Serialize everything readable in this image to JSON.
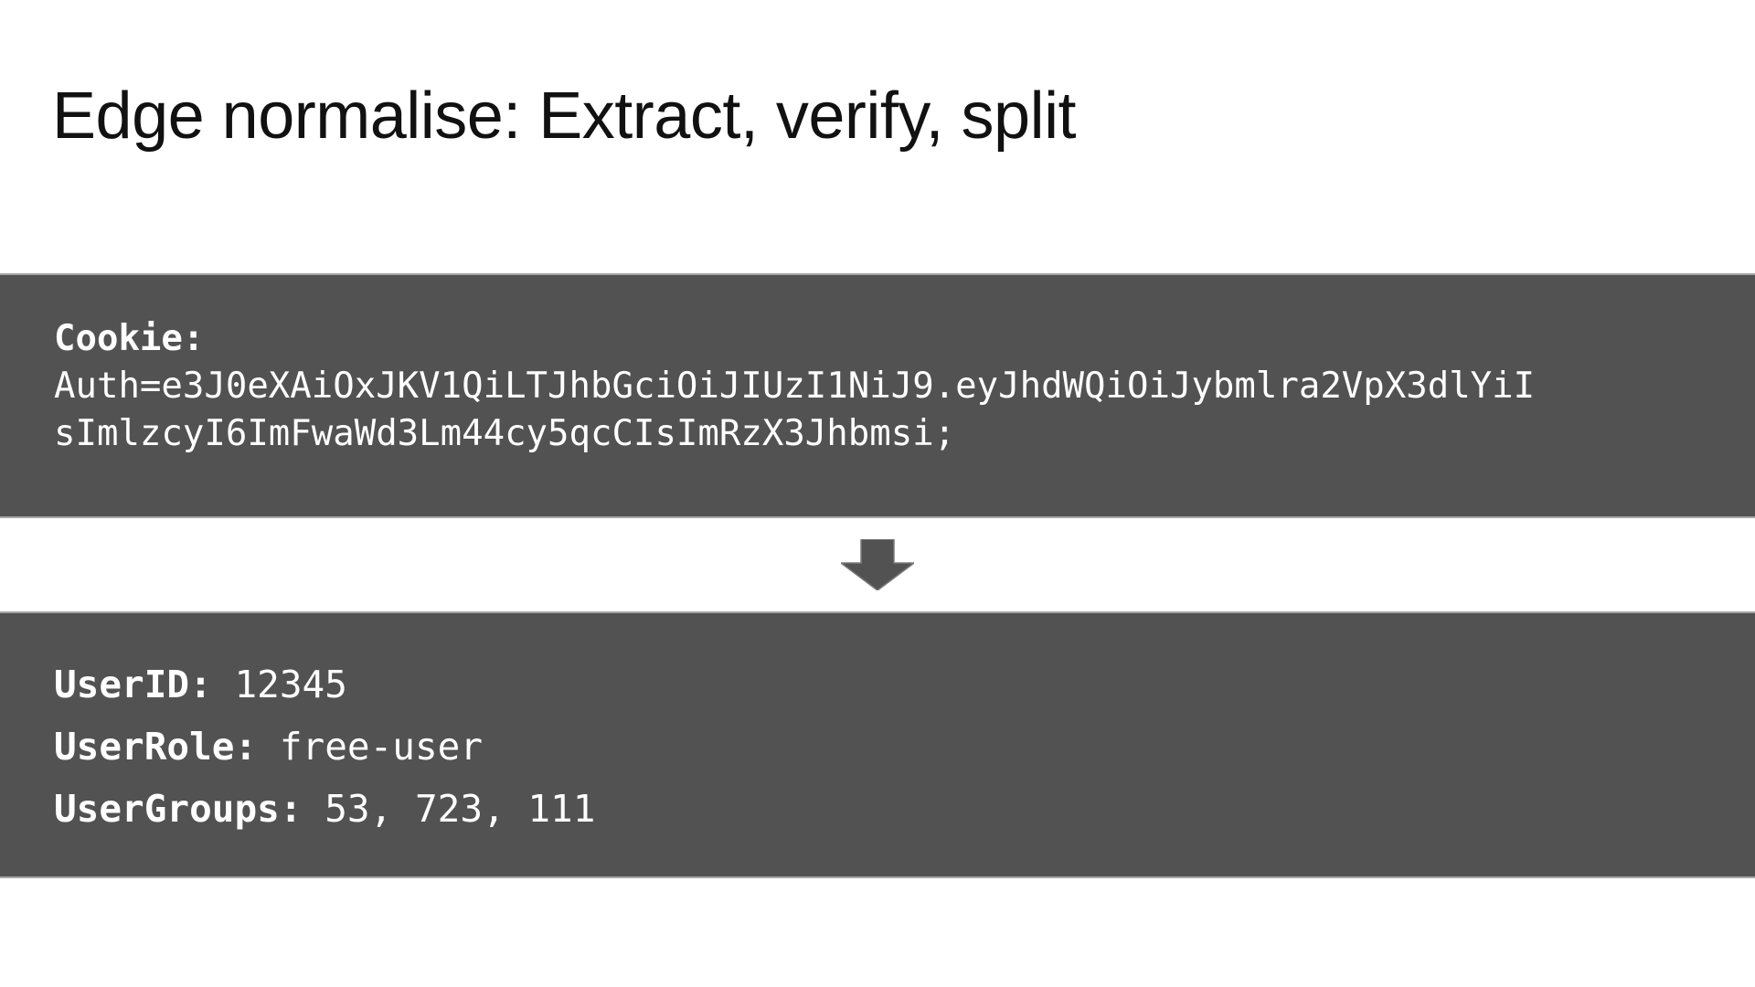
{
  "slide": {
    "title": "Edge normalise: Extract, verify, split"
  },
  "cookie": {
    "label": "Cookie:",
    "line1": "Auth=e3J0eXAiOxJKV1QiLTJhbGciOiJIUzI1NiJ9.eyJhdWQiOiJybmlra2VpX3dlYiI",
    "line2": "sImlzcyI6ImFwaWd3Lm44cy5qcCIsImRzX3Jhbmsi;"
  },
  "arrow": {
    "icon": "arrow-down-icon",
    "color": "#525252"
  },
  "user": {
    "id_label": "UserID:",
    "id_value": "12345",
    "role_label": "UserRole:",
    "role_value": "free-user",
    "groups_label": "UserGroups:",
    "groups_value": "53, 723, 111"
  },
  "colors": {
    "box_background": "#525252",
    "box_border": "#a6a6a6",
    "box_text": "#ffffff",
    "title_text": "#111111"
  }
}
